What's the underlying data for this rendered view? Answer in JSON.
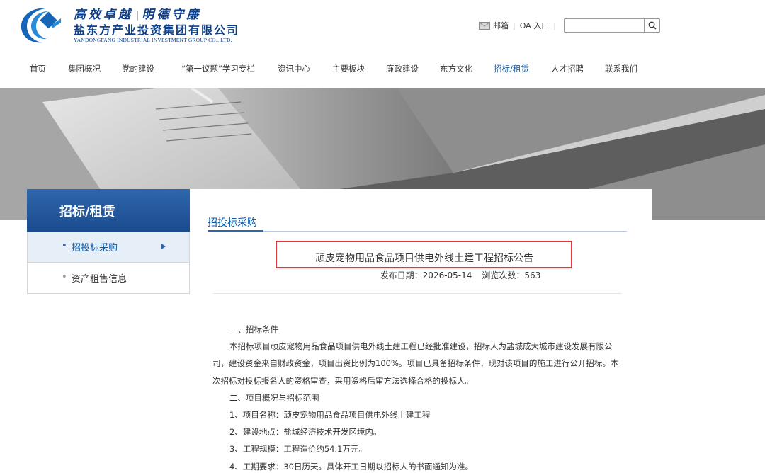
{
  "header": {
    "slogan_left": "高效卓越",
    "slogan_right": "明德守廉",
    "company_cn": "盐东方产业投资集团有限公司",
    "company_en": "YANDONGFANG INDUSTRIAL INVESTMENT GROUP CO., LTD.",
    "mail_label": "邮箱",
    "oa_label": "OA 入口",
    "search_placeholder": ""
  },
  "nav": {
    "items": [
      {
        "label": "首页"
      },
      {
        "label": "集团概况"
      },
      {
        "label": "党的建设"
      },
      {
        "label": "“第一议题”学习专栏"
      },
      {
        "label": "资讯中心"
      },
      {
        "label": "主要板块"
      },
      {
        "label": "廉政建设"
      },
      {
        "label": "东方文化"
      },
      {
        "label": "招标/租赁"
      },
      {
        "label": "人才招聘"
      },
      {
        "label": "联系我们"
      }
    ],
    "active_index": 8
  },
  "sidebar": {
    "title": "招标/租赁",
    "items": [
      {
        "label": "招投标采购",
        "active": true
      },
      {
        "label": "资产租售信息",
        "active": false
      }
    ]
  },
  "content": {
    "section_title": "招投标采购",
    "headline": "顽皮宠物用品食品项目供电外线土建工程招标公告",
    "publish_label": "发布日期：2026-05-14",
    "views_label": "浏览次数：563",
    "paragraphs": [
      "一、招标条件",
      "本招标项目顽皮宠物用品食品项目供电外线土建工程已经批准建设，招标人为盐城成大城市建设发展有限公司，建设资金来自财政资金，项目出资比例为100%。项目已具备招标条件，现对该项目的施工进行公开招标。本次招标对投标报名人的资格审查，采用资格后审方法选择合格的投标人。",
      "二、项目概况与招标范围",
      "1、项目名称：顽皮宠物用品食品项目供电外线土建工程",
      "2、建设地点：盐城经济技术开发区境内。",
      "3、工程规模：工程造价约54.1万元。",
      "4、工期要求：30日历天。具体开工日期以招标人的书面通知为准。"
    ]
  },
  "colors": {
    "brand_blue": "#0d3f8a",
    "accent_blue": "#0b5aa8",
    "highlight_red": "#e0383a"
  }
}
